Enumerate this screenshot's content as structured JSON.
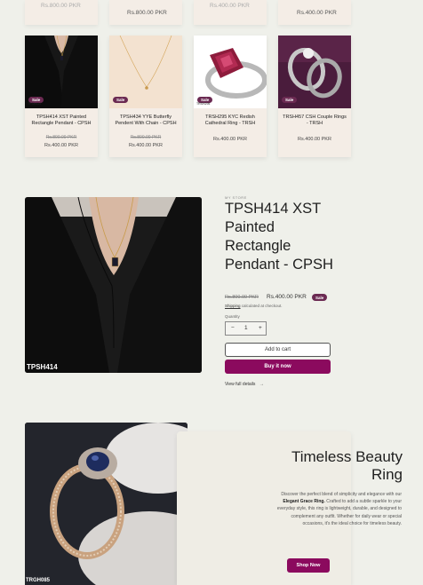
{
  "top_row": {
    "prices": [
      "Rs.800.00 PKR",
      "Rs.800.00 PKR",
      "Rs.400.00 PKR",
      "Rs.400.00 PKR"
    ]
  },
  "products": [
    {
      "badge": "Sale",
      "code": "TPSH414",
      "title": "TPSH414 XST Painted Rectangle Pendant - CPSH",
      "old_price": "Rs.800.00 PKR",
      "price": "Rs.400.00 PKR"
    },
    {
      "badge": "Sale",
      "code": "",
      "title": "TPSH434 YYE Butterfly Pendent With Chain - CPSH",
      "old_price": "Rs.800.00 PKR",
      "price": "Rs.400.00 PKR"
    },
    {
      "badge": "Sale",
      "code": "TRSH295",
      "title": "TRSH295 KYC Redish Cathedral Ring - TRSH",
      "old_price": "",
      "price": "Rs.400.00 PKR"
    },
    {
      "badge": "Sale",
      "code": "",
      "title": "TRSH457 CSH Couple Rings - TRSH",
      "old_price": "",
      "price": "Rs.400.00 PKR"
    }
  ],
  "main_product": {
    "image_code": "TPSH414",
    "vendor": "MY STORE",
    "title": "TPSH414 XST Painted Rectangle Pendant - CPSH",
    "old_price": "Rs.800.00 PKR",
    "price": "Rs.400.00 PKR",
    "badge": "Sale",
    "shipping_link": "Shipping",
    "shipping_rest": " calculated at checkout.",
    "quantity_label": "Quantity",
    "quantity": "1",
    "minus": "−",
    "plus": "+",
    "add_to_cart": "Add to cart",
    "buy_now": "Buy it now",
    "view_details": "View full details",
    "arrow": "→"
  },
  "banner": {
    "image_code": "TRGH085",
    "title": "Timeless Beauty Ring",
    "text_before": "Discover the perfect blend of simplicity and elegance with our ",
    "text_bold": "Elegant Grace Ring.",
    "text_after": " Crafted to add a subtle sparkle to your everyday style, this ring is lightweight, durable, and designed to complement any outfit. Whether for daily wear or special occasions, it's the ideal choice for timeless beauty.",
    "button": "Shop Now"
  },
  "colors": {
    "accent": "#8b0a5e",
    "badge": "#6b2a52",
    "page_bg": "#eff0ea",
    "card_bg": "#f4ede6"
  }
}
